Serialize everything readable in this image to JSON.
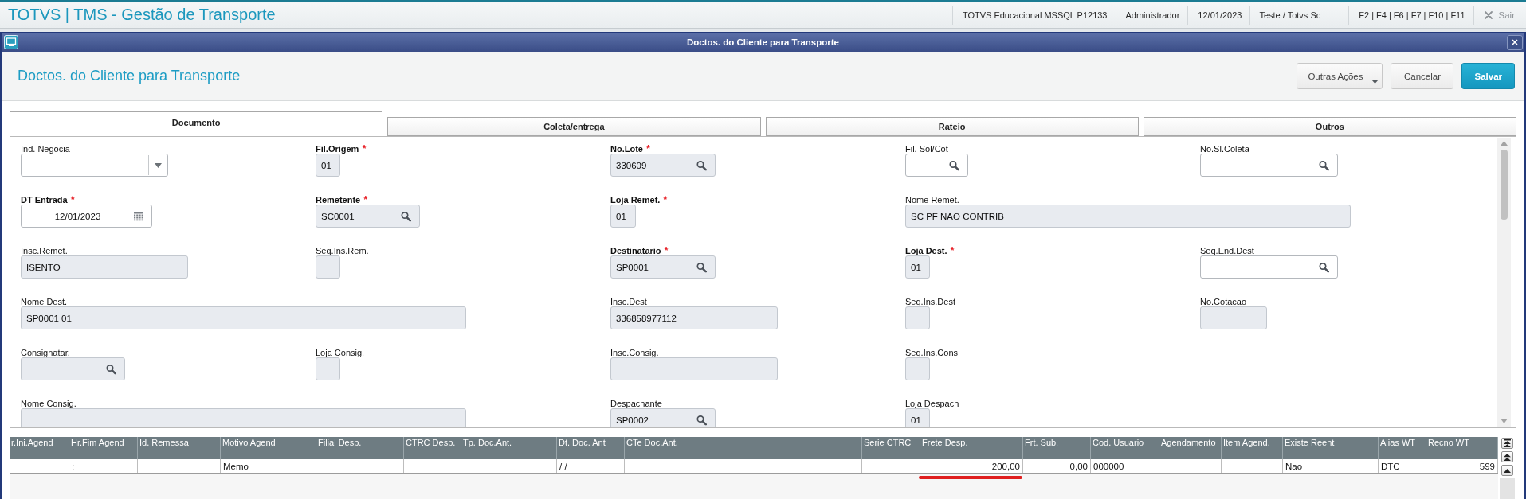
{
  "app_bar": {
    "title": "TOTVS | TMS - Gestão de Transporte",
    "info": [
      "TOTVS Educacional MSSQL P12133",
      "Administrador",
      "12/01/2023",
      "Teste / Totvs Sc"
    ],
    "shortcuts": "F2 | F4 | F6 | F7 | F10 | F11",
    "exit": "Sair"
  },
  "window": {
    "title": "Doctos. do Cliente para Transporte"
  },
  "header": {
    "title": "Doctos. do Cliente para Transporte",
    "buttons": [
      {
        "label": "Outras Ações",
        "kind": "menu"
      },
      {
        "label": "Cancelar",
        "kind": "secondary"
      },
      {
        "label": "Salvar",
        "kind": "primary"
      }
    ]
  },
  "tabs": [
    {
      "label": "Documento",
      "selected": true
    },
    {
      "label": "Coleta/entrega",
      "selected": false
    },
    {
      "label": "Rateio",
      "selected": false
    },
    {
      "label": "Outros",
      "selected": false
    }
  ],
  "form": {
    "required_mark": "*",
    "fields": [
      {
        "label": "Ind. Negocia",
        "required": false,
        "kind": "combo",
        "disabled": false
      },
      {
        "label": "Fil.Origem",
        "required": true,
        "kind": "text",
        "disabled": true,
        "value": "01"
      },
      {
        "label": "No.Lote",
        "required": true,
        "kind": "lookup",
        "disabled": true,
        "value": "330609"
      },
      {
        "label": "Fil. Sol/Cot",
        "required": false,
        "kind": "lookup",
        "disabled": false
      },
      {
        "label": "No.Sl.Coleta",
        "required": false,
        "kind": "lookup",
        "disabled": false
      },
      {
        "label": "DT Entrada",
        "required": true,
        "kind": "date",
        "disabled": false,
        "value": "12/01/2023"
      },
      {
        "label": "Remetente",
        "required": true,
        "kind": "lookup",
        "disabled": true,
        "value": "SC0001"
      },
      {
        "label": "Loja Remet.",
        "required": true,
        "kind": "text",
        "disabled": true,
        "value": "01"
      },
      {
        "label": "Nome Remet.",
        "required": false,
        "kind": "text",
        "disabled": true,
        "value": "SC PF NAO CONTRIB"
      },
      {
        "label": "Insc.Remet.",
        "required": false,
        "kind": "text",
        "disabled": true,
        "value": "ISENTO"
      },
      {
        "label": "Seq.Ins.Rem.",
        "required": false,
        "kind": "text",
        "disabled": true
      },
      {
        "label": "Destinatario",
        "required": true,
        "kind": "lookup",
        "disabled": true,
        "value": "SP0001"
      },
      {
        "label": "Loja Dest.",
        "required": true,
        "kind": "text",
        "disabled": true,
        "value": "01"
      },
      {
        "label": "Seq.End.Dest",
        "required": false,
        "kind": "lookup",
        "disabled": false
      },
      {
        "label": "Nome Dest.",
        "required": false,
        "kind": "text",
        "disabled": true,
        "value": "SP0001 01"
      },
      {
        "label": "Insc.Dest",
        "required": false,
        "kind": "text",
        "disabled": true,
        "value": "336858977112"
      },
      {
        "label": "Seq.Ins.Dest",
        "required": false,
        "kind": "text",
        "disabled": true
      },
      {
        "label": "No.Cotacao",
        "required": false,
        "kind": "text",
        "disabled": true
      },
      {
        "label": "Consignatar.",
        "required": false,
        "kind": "lookup",
        "disabled": true
      },
      {
        "label": "Loja Consig.",
        "required": false,
        "kind": "text",
        "disabled": true
      },
      {
        "label": "Insc.Consig.",
        "required": false,
        "kind": "text",
        "disabled": true
      },
      {
        "label": "Seq.Ins.Cons",
        "required": false,
        "kind": "text",
        "disabled": true
      },
      {
        "label": "Nome Consig.",
        "required": false,
        "kind": "text",
        "disabled": true
      },
      {
        "label": "Despachante",
        "required": false,
        "kind": "lookup",
        "disabled": true,
        "value": "SP0002"
      },
      {
        "label": "Loja Despach",
        "required": false,
        "kind": "text",
        "disabled": true,
        "value": "01"
      }
    ]
  },
  "grid": {
    "columns": [
      {
        "label": "r.Ini.Agend",
        "kind": "text",
        "marked": false
      },
      {
        "label": "Hr.Fim Agend",
        "kind": "text",
        "marked": false
      },
      {
        "label": "Id. Remessa",
        "kind": "text",
        "marked": false
      },
      {
        "label": "Motivo Agend",
        "kind": "text",
        "marked": false
      },
      {
        "label": "Filial Desp.",
        "kind": "text",
        "marked": false
      },
      {
        "label": "CTRC Desp.",
        "kind": "text",
        "marked": false
      },
      {
        "label": "Tp. Doc.Ant.",
        "kind": "text",
        "marked": false
      },
      {
        "label": "Dt. Doc. Ant",
        "kind": "text",
        "marked": false
      },
      {
        "label": "CTe Doc.Ant.",
        "kind": "text",
        "marked": false
      },
      {
        "label": "Serie CTRC",
        "kind": "text",
        "marked": false
      },
      {
        "label": "Frete Desp.",
        "kind": "number",
        "marked": true
      },
      {
        "label": "Frt. Sub.",
        "kind": "number",
        "marked": false
      },
      {
        "label": "Cod. Usuario",
        "kind": "text",
        "marked": false
      },
      {
        "label": "Agendamento",
        "kind": "text",
        "marked": false
      },
      {
        "label": "Item Agend.",
        "kind": "text",
        "marked": false
      },
      {
        "label": "Existe Reent",
        "kind": "text",
        "marked": false
      },
      {
        "label": "Alias WT",
        "kind": "text",
        "marked": false
      },
      {
        "label": "Recno WT",
        "kind": "number",
        "marked": false
      }
    ],
    "rows": [
      {
        "cells": [
          null,
          ":",
          null,
          "Memo",
          null,
          null,
          null,
          "/ /",
          null,
          null,
          "200,00",
          "0,00",
          "000000",
          null,
          null,
          "Nao",
          "DTC",
          "599"
        ]
      }
    ]
  }
}
